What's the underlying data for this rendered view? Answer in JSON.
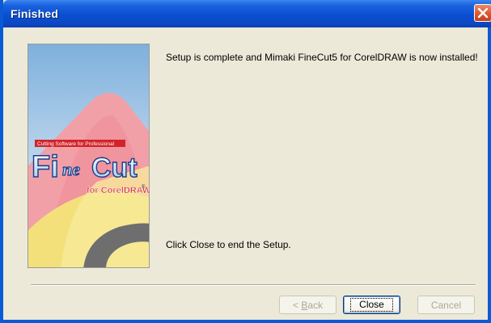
{
  "window": {
    "title": "Finished",
    "close_icon": "close-x-icon"
  },
  "banner": {
    "tagline": "Cutting Software for Professional",
    "logo_main_1": "Fi",
    "logo_main_2": "ne",
    "logo_main_3": "Cut",
    "logo_sub": "for CorelDRAW",
    "logo_reg": "®"
  },
  "main": {
    "message_top": "Setup is complete and Mimaki FineCut5 for CorelDRAW is now installed!",
    "message_bottom": "Click Close to end the Setup."
  },
  "buttons": {
    "back": {
      "label_prefix": "< ",
      "label_ul": "B",
      "label_rest": "ack",
      "enabled": false
    },
    "close": {
      "label": "Close",
      "enabled": true,
      "default": true
    },
    "cancel": {
      "label": "Cancel",
      "enabled": false
    }
  },
  "colors": {
    "title_bar": "#0a4fd0",
    "dialog_bg": "#ece9d8",
    "close_button": "#d9542f"
  }
}
